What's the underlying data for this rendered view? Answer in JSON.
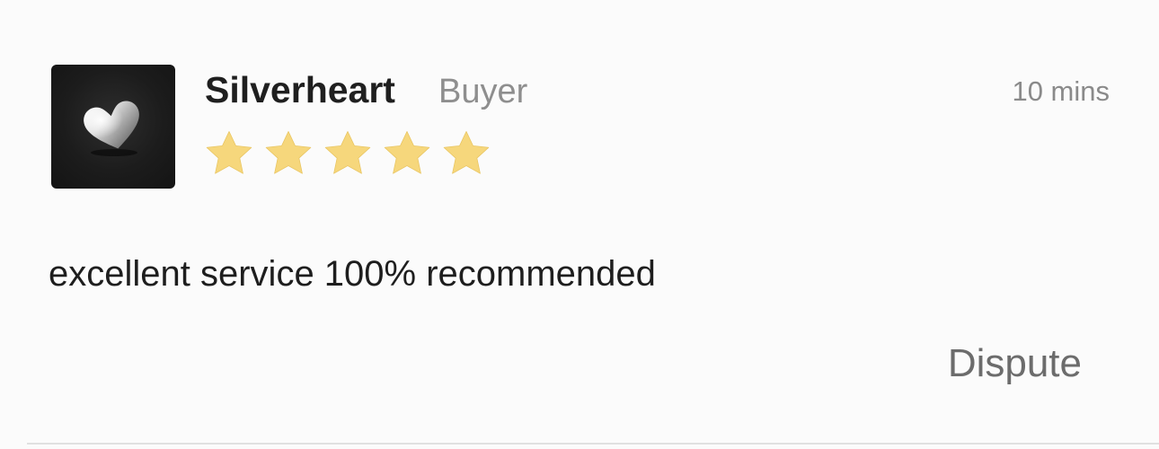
{
  "review": {
    "avatar_icon": "silver-heart-icon",
    "username": "Silverheart",
    "role": "Buyer",
    "time": "10 mins",
    "rating": 5,
    "rating_max": 5,
    "comment": "excellent service 100% recommended",
    "dispute_label": "Dispute"
  },
  "colors": {
    "star": "#f6d77c",
    "avatar_bg": "#1c1c1c",
    "muted_text": "#8e8e8e"
  }
}
